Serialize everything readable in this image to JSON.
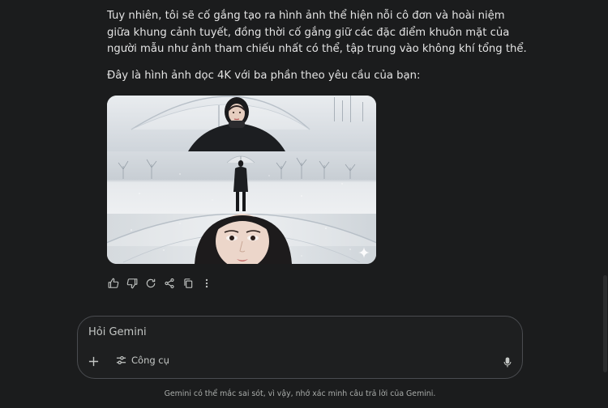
{
  "response": {
    "paragraph_1": "Tuy nhiên, tôi sẽ cố gắng tạo ra hình ảnh thể hiện nỗi cô đơn và hoài niệm giữa khung cảnh tuyết, đồng thời cố gắng giữ các đặc điểm khuôn mặt của người mẫu như ảnh tham chiếu nhất có thể, tập trung vào không khí tổng thể.",
    "paragraph_2": "Đây là hình ảnh dọc 4K với ba phần theo yêu cầu của bạn:"
  },
  "actions": [
    "thumbs-up-icon",
    "thumbs-down-icon",
    "regenerate-icon",
    "share-icon",
    "copy-icon",
    "more-options-icon"
  ],
  "composer": {
    "placeholder": "Hỏi Gemini",
    "tools_label": "Công cụ"
  },
  "disclaimer": "Gemini có thể mắc sai sót, vì vậy, nhớ xác minh câu trả lời của Gemini.",
  "colors": {
    "background": "#1b1c1d",
    "text": "#e3e3e3",
    "muted": "#c4c7c5",
    "border": "#4a4c50"
  }
}
